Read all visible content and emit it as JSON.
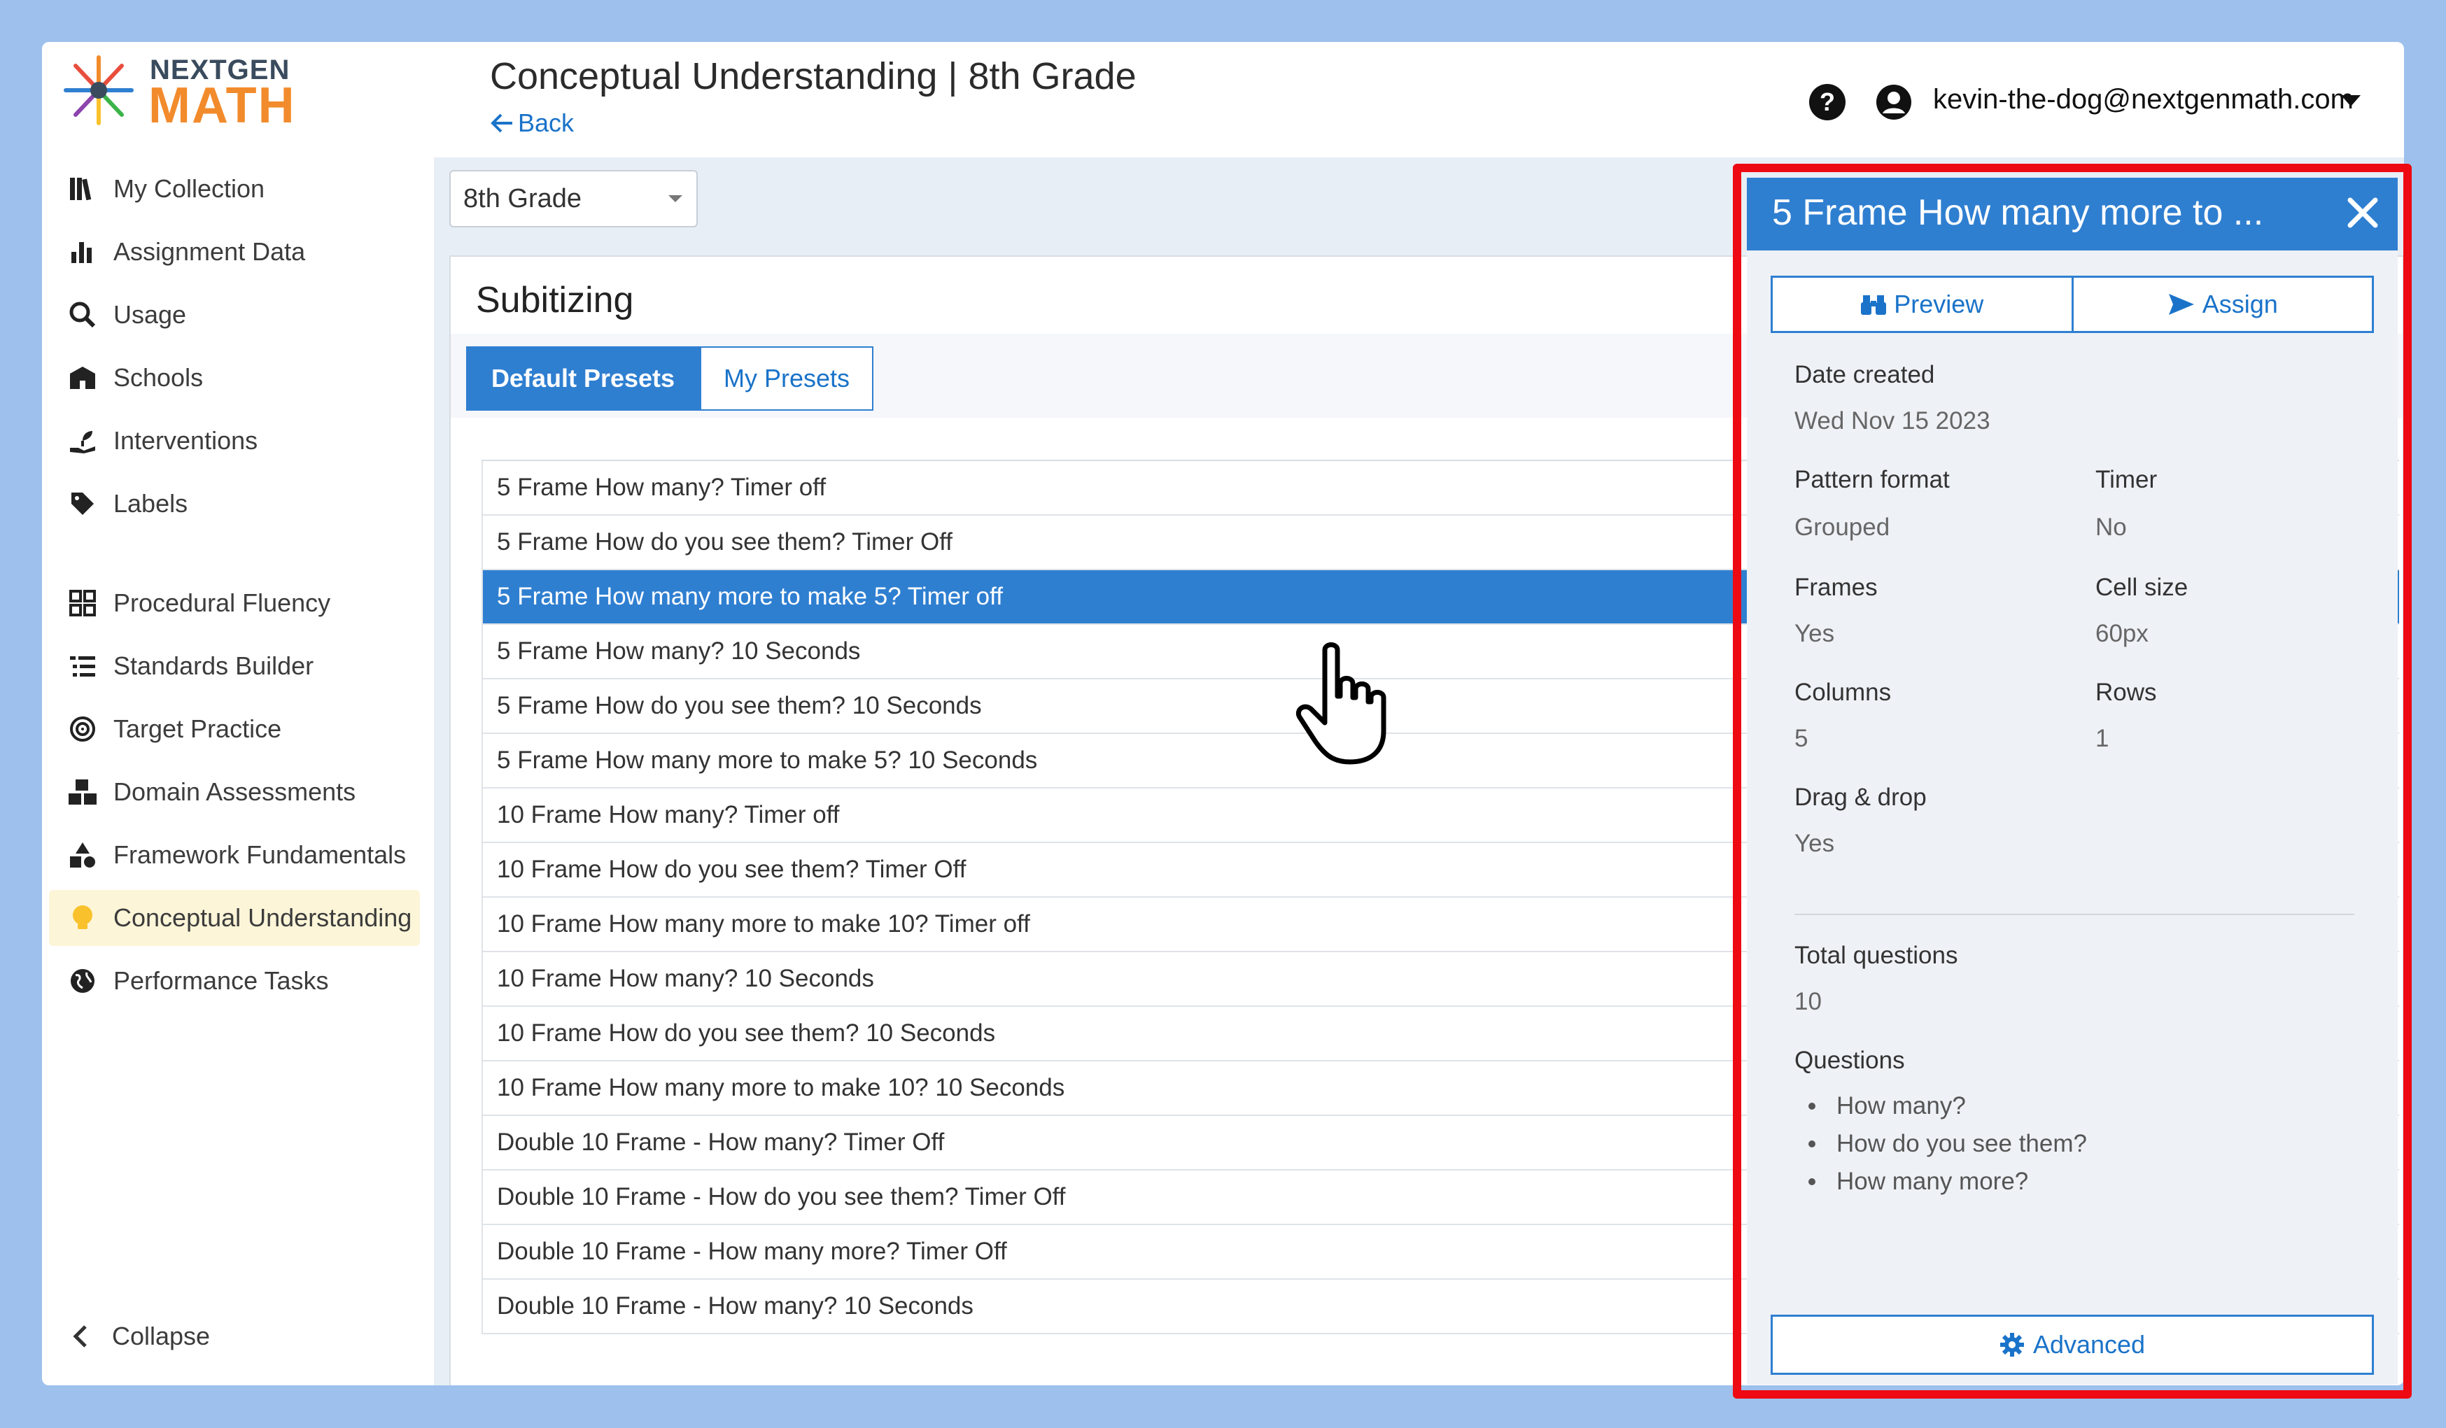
{
  "logo": {
    "line1": "NEXTGEN",
    "line2": "MATH"
  },
  "sidebar": {
    "items": [
      {
        "label": "My Collection",
        "icon": "library-icon"
      },
      {
        "label": "Assignment Data",
        "icon": "bar-chart-icon"
      },
      {
        "label": "Usage",
        "icon": "magnify-chart-icon"
      },
      {
        "label": "Schools",
        "icon": "school-icon"
      },
      {
        "label": "Interventions",
        "icon": "hand-seedling-icon"
      },
      {
        "label": "Labels",
        "icon": "tag-icon"
      },
      {
        "label": "Procedural Fluency",
        "icon": "grid-icon"
      },
      {
        "label": "Standards Builder",
        "icon": "list-tree-icon"
      },
      {
        "label": "Target Practice",
        "icon": "target-icon"
      },
      {
        "label": "Domain Assessments",
        "icon": "cubes-icon"
      },
      {
        "label": "Framework Fundamentals",
        "icon": "shapes-icon"
      },
      {
        "label": "Conceptual Understanding",
        "icon": "lightbulb-icon",
        "active": true
      },
      {
        "label": "Performance Tasks",
        "icon": "globe-icon"
      }
    ],
    "collapse_label": "Collapse"
  },
  "header": {
    "title": "Conceptual Understanding | 8th Grade",
    "back_label": "Back",
    "help_label": "?",
    "user_email": "kevin-the-dog@nextgenmath.com"
  },
  "main": {
    "grade_select": "8th Grade",
    "section_title": "Subitizing",
    "tabs": [
      {
        "label": "Default Presets",
        "active": true
      },
      {
        "label": "My Presets",
        "active": false
      }
    ],
    "presets": [
      "5 Frame How many? Timer off",
      "5 Frame How do you see them? Timer Off",
      "5 Frame How many more to make 5? Timer off",
      "5 Frame How many? 10 Seconds",
      "5 Frame How do you see them? 10 Seconds",
      "5 Frame How many more to make 5? 10 Seconds",
      "10 Frame How many? Timer off",
      "10 Frame How do you see them? Timer Off",
      "10 Frame How many more to make 10? Timer off",
      "10 Frame How many? 10 Seconds",
      "10 Frame How do you see them? 10 Seconds",
      "10 Frame How many more to make 10? 10 Seconds",
      "Double 10 Frame - How many? Timer Off",
      "Double 10 Frame - How do you see them? Timer Off",
      "Double 10 Frame - How many more? Timer Off",
      "Double 10 Frame - How many? 10 Seconds"
    ],
    "selected_index": 2
  },
  "panel": {
    "title": "5 Frame How many more to ...",
    "preview_label": "Preview",
    "assign_label": "Assign",
    "date_created_label": "Date created",
    "date_created": "Wed Nov 15 2023",
    "pattern_format_label": "Pattern format",
    "pattern_format": "Grouped",
    "timer_label": "Timer",
    "timer": "No",
    "frames_label": "Frames",
    "frames": "Yes",
    "cell_size_label": "Cell size",
    "cell_size": "60px",
    "columns_label": "Columns",
    "columns": "5",
    "rows_label": "Rows",
    "rows": "1",
    "drag_drop_label": "Drag & drop",
    "drag_drop": "Yes",
    "total_questions_label": "Total questions",
    "total_questions": "10",
    "questions_label": "Questions",
    "questions": [
      "How many?",
      "How do you see them?",
      "How many more?"
    ],
    "advanced_label": "Advanced"
  },
  "colors": {
    "accent": "#2f7fd1",
    "highlight_outline": "#ee0a12",
    "logo_orange": "#f28b2c"
  }
}
